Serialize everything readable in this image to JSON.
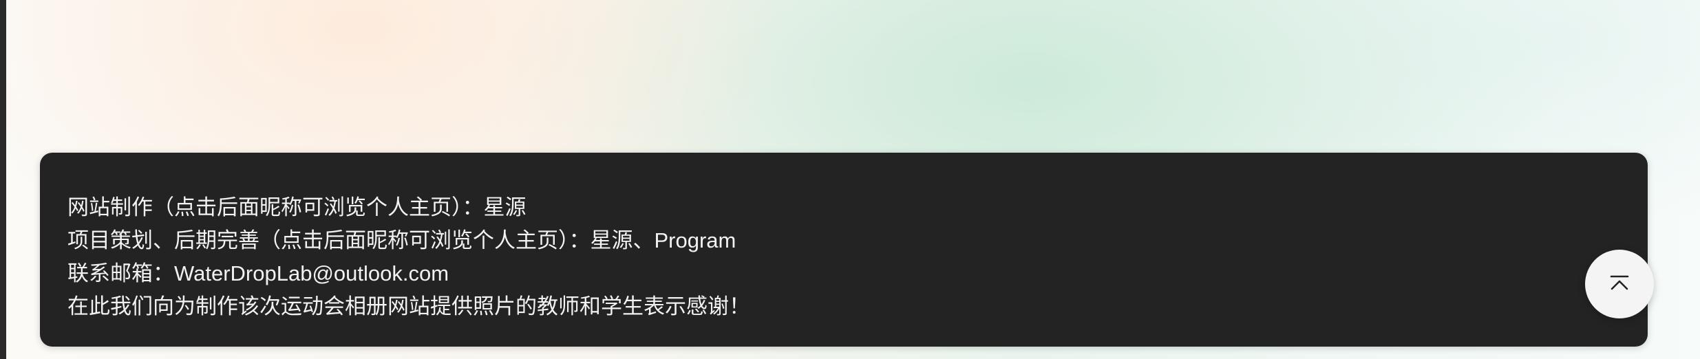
{
  "footer": {
    "lines": [
      "网站制作（点击后面昵称可浏览个人主页）：星源",
      "项目策划、后期完善（点击后面昵称可浏览个人主页）：星源、Program",
      "联系邮箱：WaterDropLab@outlook.com",
      "在此我们向为制作该次运动会相册网站提供照片的教师和学生表示感谢！"
    ]
  },
  "back_to_top": {
    "icon": "arrow-up-to-line-icon"
  }
}
